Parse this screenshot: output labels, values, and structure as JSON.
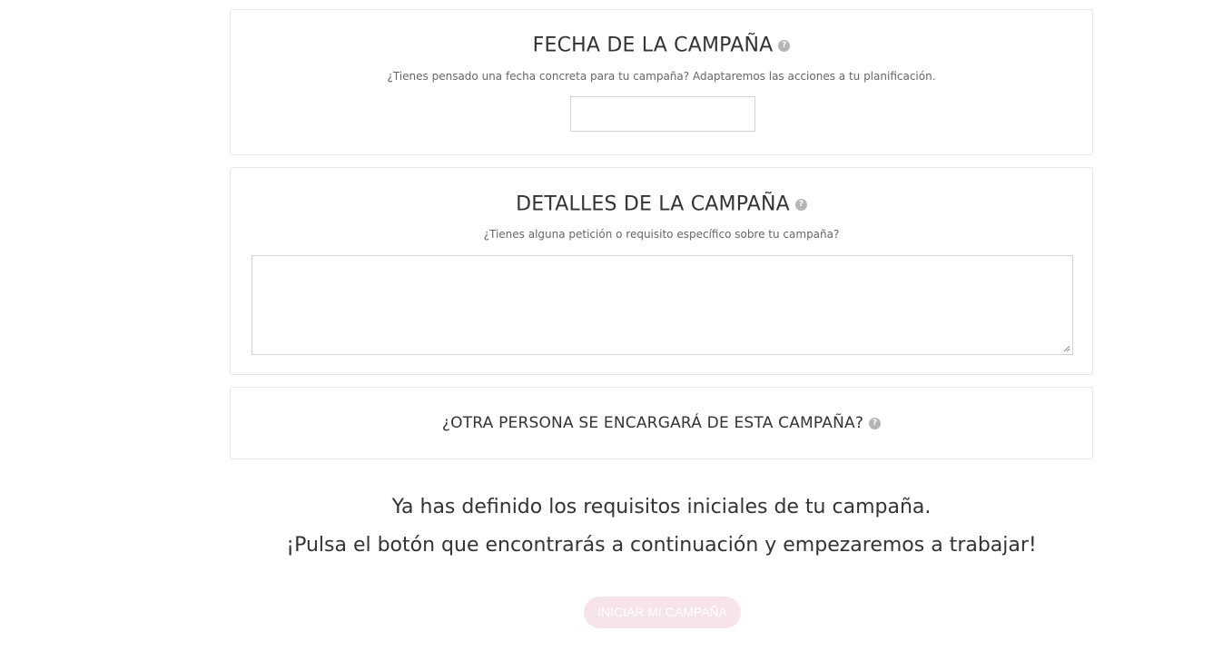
{
  "date_section": {
    "title": "FECHA DE LA CAMPAÑA",
    "help_icon": "?",
    "subtitle": "¿Tienes pensado una fecha concreta para tu campaña? Adaptaremos las acciones a tu planificación.",
    "date_value": ""
  },
  "details_section": {
    "title": "DETALLES DE LA CAMPAÑA",
    "help_icon": "?",
    "subtitle": "¿Tienes alguna petición o requisito específico sobre tu campaña?",
    "details_value": ""
  },
  "other_person_section": {
    "title": "¿OTRA PERSONA SE ENCARGARÁ DE ESTA CAMPAÑA?",
    "help_icon": "?"
  },
  "final_message": {
    "line1": "Ya has definido los requisitos iniciales de tu campaña.",
    "line2": "¡Pulsa el botón que encontrarás a continuación y empezaremos a trabajar!"
  },
  "start_button": {
    "label": "INICIAR MI CAMPAÑA"
  },
  "colors": {
    "button_bg": "#f7e4ea",
    "border": "#e6e6e6",
    "help_icon_bg": "#b5b5b5"
  }
}
